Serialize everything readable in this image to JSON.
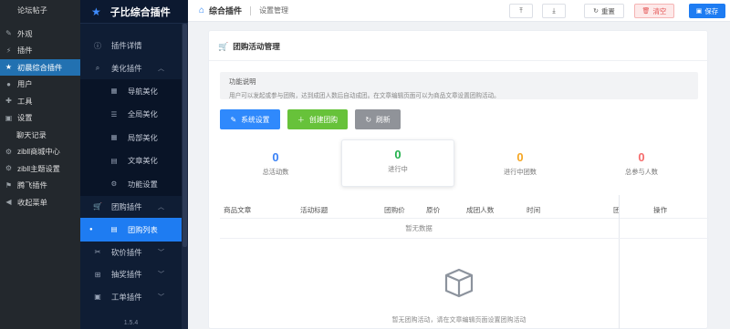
{
  "wp_sidebar": {
    "items": [
      {
        "label": "论坛帖子",
        "icon": "forum-icon"
      },
      {
        "label": "外观",
        "icon": "appearance-icon"
      },
      {
        "label": "插件",
        "icon": "plugin-icon"
      },
      {
        "label": "初晨综合插件",
        "icon": "star-icon",
        "active": true
      },
      {
        "label": "用户",
        "icon": "user-icon"
      },
      {
        "label": "工具",
        "icon": "tools-icon"
      },
      {
        "label": "设置",
        "icon": "settings-icon"
      },
      {
        "label": "聊天记录",
        "icon": ""
      },
      {
        "label": "zibll商城中心",
        "icon": "gear-icon"
      },
      {
        "label": "zibll主题设置",
        "icon": "gear-icon"
      },
      {
        "label": "腾飞插件",
        "icon": "flag-icon"
      },
      {
        "label": "收起菜单",
        "icon": "collapse-icon"
      }
    ]
  },
  "plugin_nav": {
    "title": "子比综合插件",
    "items": [
      {
        "label": "插件详情",
        "icon": "info-icon",
        "chevron": ""
      },
      {
        "label": "美化插件",
        "icon": "search-icon",
        "chevron": "︿"
      }
    ],
    "beautify_subs": [
      {
        "label": "导航美化",
        "icon": "grid-icon"
      },
      {
        "label": "全局美化",
        "icon": "sliders-icon"
      },
      {
        "label": "局部美化",
        "icon": "grid-icon"
      },
      {
        "label": "文章美化",
        "icon": "doc-icon"
      },
      {
        "label": "功能设置",
        "icon": "gear-icon"
      }
    ],
    "group_item": {
      "label": "团购插件",
      "icon": "cart-icon",
      "chevron": "︿"
    },
    "group_sub": {
      "label": "团购列表",
      "icon": "list-icon"
    },
    "more_items": [
      {
        "label": "砍价插件",
        "icon": "scissors-icon",
        "chevron": "﹀"
      },
      {
        "label": "抽奖插件",
        "icon": "gift-icon",
        "chevron": "﹀"
      },
      {
        "label": "工单插件",
        "icon": "ticket-icon",
        "chevron": "﹀"
      }
    ],
    "version": "1.5.4"
  },
  "topbar": {
    "section": "综合插件",
    "page": "设置管理",
    "buttons": {
      "upload": "⤒",
      "download": "⤓",
      "reset": "重置",
      "clear": "清空",
      "save": "保存"
    }
  },
  "card": {
    "title": "团购活动管理",
    "notice_title": "功能说明",
    "notice_text": "用户可以发起或参与团购，达到成团人数后自动成团。在文章编辑页面可以为商品文章设置团购活动。",
    "actions": {
      "settings": "系统设置",
      "create": "创建团购",
      "refresh": "刷新"
    },
    "stats": [
      {
        "value": "0",
        "label": "总活动数",
        "color": "#3b82f6"
      },
      {
        "value": "0",
        "label": "进行中",
        "color": "#22b14c"
      },
      {
        "value": "0",
        "label": "进行中团数",
        "color": "#f5a623"
      },
      {
        "value": "0",
        "label": "总参与人数",
        "color": "#f56c6c"
      }
    ],
    "table_headers": [
      "商品文章",
      "活动标题",
      "团购价",
      "原价",
      "成团人数",
      "时间"
    ],
    "table_right_headers": [
      "团",
      "操作"
    ],
    "no_data": "暂无数据",
    "empty_message": "暂无团购活动，请在文章编辑页面设置团购活动"
  },
  "colors": {
    "primary": "#1e7cf2",
    "wp_active": "#2271b1",
    "green": "#67c23a",
    "gray_btn": "#909399"
  }
}
